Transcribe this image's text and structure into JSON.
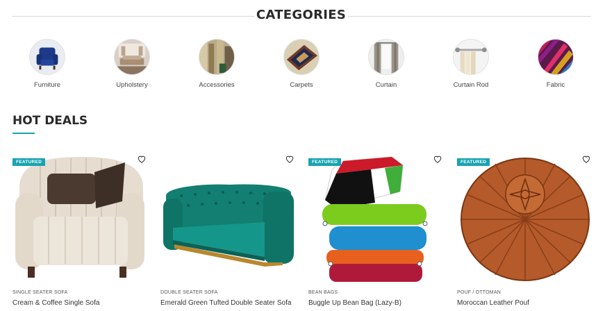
{
  "categories_section": {
    "title": "CATEGORIES",
    "items": [
      {
        "label": "Furniture",
        "icon": "armchair-thumb"
      },
      {
        "label": "Upholstery",
        "icon": "room-thumb"
      },
      {
        "label": "Accessories",
        "icon": "accessories-thumb"
      },
      {
        "label": "Carpets",
        "icon": "carpet-thumb"
      },
      {
        "label": "Curtain",
        "icon": "curtain-thumb"
      },
      {
        "label": "Curtain Rod",
        "icon": "curtain-rod-thumb"
      },
      {
        "label": "Fabric",
        "icon": "fabric-thumb"
      }
    ]
  },
  "hot_deals": {
    "title": "HOT DEALS",
    "accent_color": "#17a3b2",
    "products": [
      {
        "category": "SINGLE SEATER SOFA",
        "name": "Cream & Coffee Single Sofa",
        "badge": "FEATURED"
      },
      {
        "category": "DOUBLE SEATER SOFA",
        "name": "Emerald Green Tufted Double Seater Sofa",
        "badge": ""
      },
      {
        "category": "BEAN BAGS",
        "name": "Buggle Up Bean Bag (Lazy-B)",
        "badge": "FEATURED"
      },
      {
        "category": "POUF / OTTOMAN",
        "name": "Moroccan Leather Pouf",
        "badge": "FEATURED"
      }
    ]
  }
}
